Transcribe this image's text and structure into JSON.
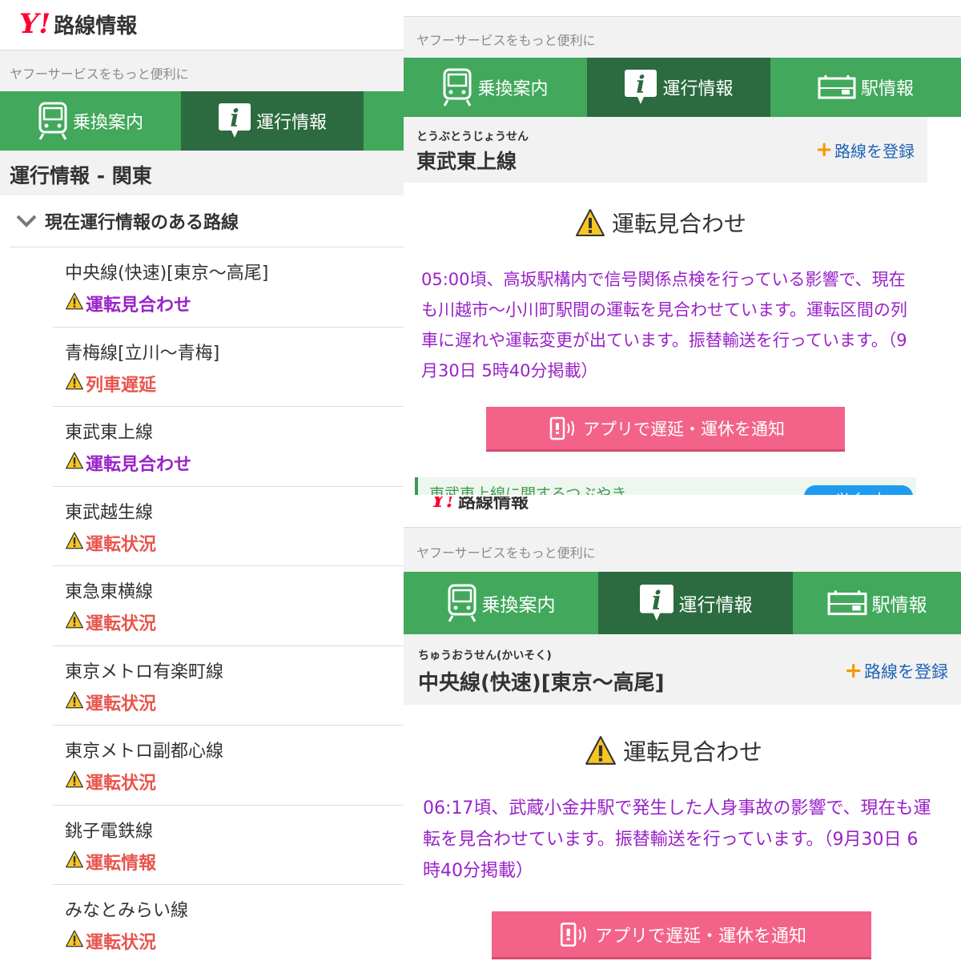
{
  "left": {
    "logo_mark": "Y!",
    "logo_text": "路線情報",
    "promo": "ヤフーサービスをもっと便利に",
    "tabs": [
      {
        "label": "乗換案内",
        "icon": "train-icon"
      },
      {
        "label": "運行情報",
        "icon": "info-icon"
      }
    ],
    "section_title": "運行情報 - 関東",
    "subhead": "現在運行情報のある路線",
    "lines": [
      {
        "name": "中央線(快速)[東京～高尾]",
        "status": "運転見合わせ",
        "color": "#9922c8"
      },
      {
        "name": "青梅線[立川～青梅]",
        "status": "列車遅延",
        "color": "#e8554e"
      },
      {
        "name": "東武東上線",
        "status": "運転見合わせ",
        "color": "#9922c8"
      },
      {
        "name": "東武越生線",
        "status": "運転状況",
        "color": "#e8554e"
      },
      {
        "name": "東急東横線",
        "status": "運転状況",
        "color": "#e8554e"
      },
      {
        "name": "東京メトロ有楽町線",
        "status": "運転状況",
        "color": "#e8554e"
      },
      {
        "name": "東京メトロ副都心線",
        "status": "運転状況",
        "color": "#e8554e"
      },
      {
        "name": "銚子電鉄線",
        "status": "運転情報",
        "color": "#e8554e"
      },
      {
        "name": "みなとみらい線",
        "status": "運転状況",
        "color": "#e8554e"
      }
    ]
  },
  "top_right": {
    "promo": "ヤフーサービスをもっと便利に",
    "tabs": [
      {
        "label": "乗換案内",
        "icon": "train-icon"
      },
      {
        "label": "運行情報",
        "icon": "info-icon"
      },
      {
        "label": "駅情報",
        "icon": "station-sign-icon"
      }
    ],
    "kana": "とうぶとうじょうせん",
    "line_name": "東武東上線",
    "register": "路線を登録",
    "status": "運転見合わせ",
    "message": "05:00頃、高坂駅構内で信号関係点検を行っている影響で、現在も川越市～小川町駅間の運転を見合わせています。運転区間の列車に遅れや運転変更が出ています。振替輸送を行っています。（9月30日 5時40分掲載）",
    "notify": "アプリで遅延・運休を通知",
    "tweet_label": "東武東上線に関するつぶやき",
    "tweet_button": "ツイート"
  },
  "bottom_right": {
    "logo_mark": "Y!",
    "logo_text": "路線情報",
    "promo": "ヤフーサービスをもっと便利に",
    "tabs": [
      {
        "label": "乗換案内",
        "icon": "train-icon"
      },
      {
        "label": "運行情報",
        "icon": "info-icon"
      },
      {
        "label": "駅情報",
        "icon": "station-sign-icon"
      }
    ],
    "kana": "ちゅうおうせん(かいそく)",
    "line_name": "中央線(快速)[東京～高尾]",
    "register": "路線を登録",
    "status": "運転見合わせ",
    "message": "06:17頃、武蔵小金井駅で発生した人身事故の影響で、現在も運転を見合わせています。振替輸送を行っています。（9月30日 6時40分掲載）",
    "notify": "アプリで遅延・運休を通知"
  },
  "colors": {
    "tab_green": "#42a85c",
    "tab_active": "#2b6b3f",
    "status_purple": "#9922c8",
    "status_red": "#e8554e",
    "notify_pink": "#f36389",
    "register_blue": "#1f64b5",
    "plus_orange": "#f39800"
  }
}
